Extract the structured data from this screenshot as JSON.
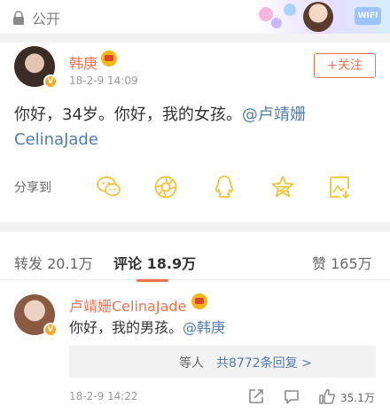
{
  "topbar": {
    "visibility_label": "公开",
    "visibility_icon": "lock-icon",
    "banner_badge": "WIFI"
  },
  "post": {
    "username": "韩庚",
    "timestamp": "18-2-9 14:09",
    "follow_label": "+关注",
    "text_before": "你好，34岁。你好，我的女孩。",
    "mention": "@卢靖姗CelinaJade"
  },
  "share": {
    "label": "分享到",
    "icons": [
      "wechat-icon",
      "moments-icon",
      "qq-icon",
      "qzone-icon",
      "save-image-icon"
    ],
    "colors": {
      "icon": "#f2c230"
    }
  },
  "tabs": {
    "repost": "转发 20.1万",
    "comments_label": "评论",
    "comments_count": "18.9万",
    "likes": "赞 165万"
  },
  "comment": {
    "username": "卢靖姗CelinaJade",
    "text_before": "你好，我的男孩。",
    "mention": "@韩庚",
    "replies_prefix": "等人",
    "replies_link": "共8772条回复 >",
    "timestamp": "18-2-9 14:22",
    "likes": "35.1万"
  },
  "colors": {
    "accent": "#eb7350",
    "link": "#507daf",
    "muted": "#999999",
    "divider": "#f2f2f2"
  }
}
